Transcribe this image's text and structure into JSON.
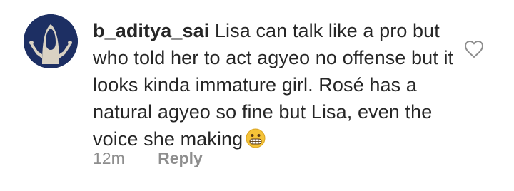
{
  "comment": {
    "username": "b_aditya_sai",
    "text": "Lisa can talk like a pro but who told her to act agyeo no offense but it looks kinda immature girl. Rosé has a natural agyeo so fine but Lisa, even the voice she making",
    "emoji_icon": "grimacing-face-emoji",
    "timestamp": "12m",
    "reply_label": "Reply",
    "like_icon": "heart-outline-icon",
    "avatar_icon": "hooded-figure-avatar"
  },
  "colors": {
    "text": "#262626",
    "secondary": "#8e8e8e",
    "avatar_bg": "#1d2f63"
  }
}
